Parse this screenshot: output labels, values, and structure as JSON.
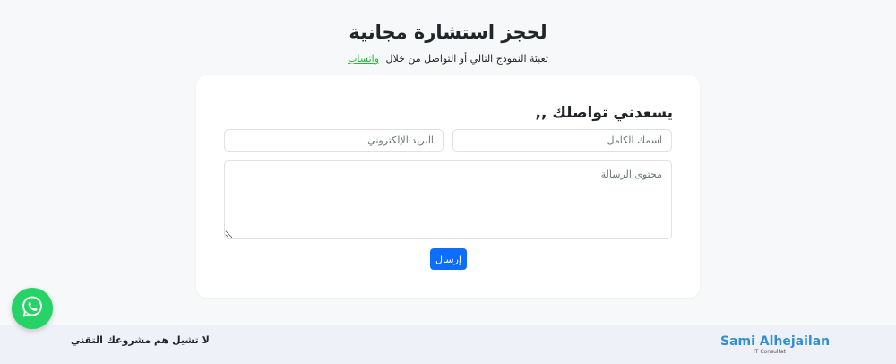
{
  "hero": {
    "title": "لحجز استشارة مجانية",
    "subtitle_text": "تعبئة النموذج التالي أو التواصل من خلال",
    "whatsapp_link": "واتساب"
  },
  "form": {
    "heading": "يسعدني تواصلك ,,",
    "name_placeholder": "اسمك الكامل",
    "email_placeholder": "البريد الإلكتروني",
    "message_placeholder": "محتوى الرسالة",
    "submit_label": "إرسال"
  },
  "footer": {
    "tagline": "لا تشيل هم مشروعك التقني",
    "logo_name": "Sami Alhejailan",
    "logo_sub": "IT Consultat"
  },
  "colors": {
    "primary": "#0d6efd",
    "whatsapp": "#25d366",
    "link": "#25b83a",
    "logo": "#2e8fd6"
  },
  "icons": {
    "floating_button": "whatsapp-icon"
  }
}
